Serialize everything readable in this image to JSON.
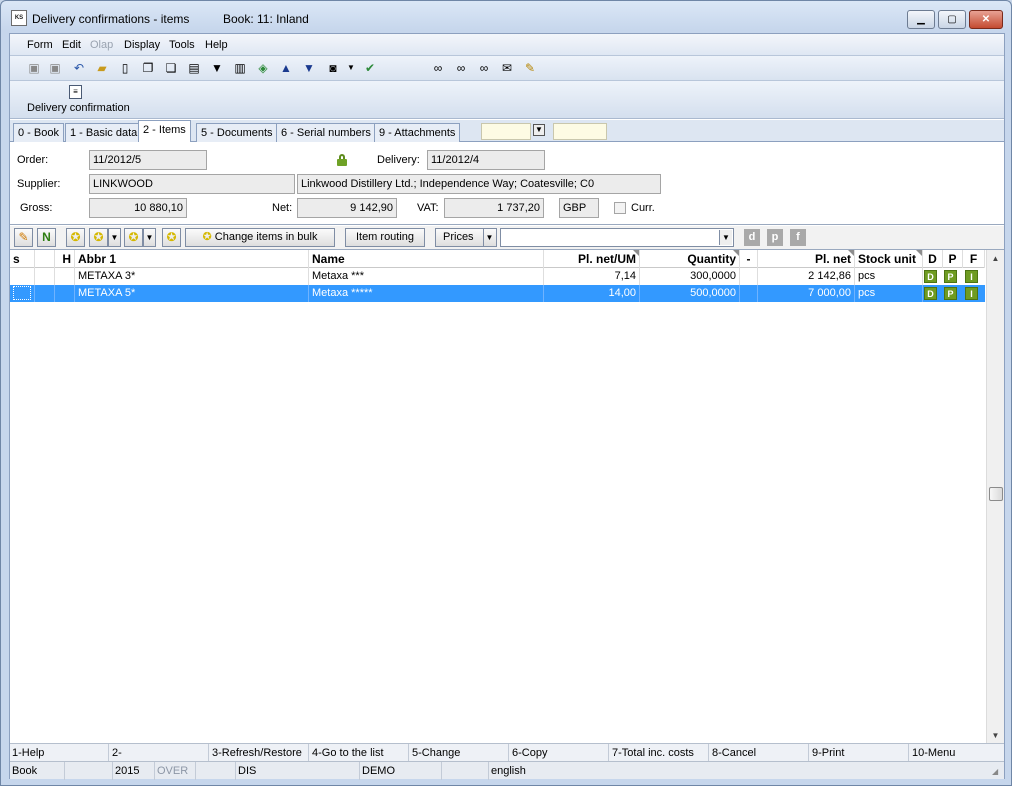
{
  "window": {
    "title": "Delivery confirmations - items",
    "book": "Book: 11: Inland",
    "app_icon": "KS"
  },
  "menu": [
    "Form",
    "Edit",
    "Olap",
    "Display",
    "Tools",
    "Help"
  ],
  "toolbar_icons": [
    "save-icon",
    "save-all-icon",
    "undo-icon",
    "open-folder-icon",
    "new-document-icon",
    "copy-document-icon",
    "paste-document-icon",
    "book-icon",
    "filter-icon",
    "filter-list-icon",
    "stack-icon",
    "arrow-up-icon",
    "arrow-down-icon",
    "camera-icon",
    "dropdown-arrow-icon",
    "check-icon",
    "binoculars-icon",
    "find-next-icon",
    "find-prev-icon",
    "envelope-icon",
    "edit-notes-icon"
  ],
  "actionbar": {
    "label": "Delivery confirmation",
    "icon": "document-icon"
  },
  "tabs": [
    "0 - Book",
    "1 - Basic data",
    "2 - Items",
    "5 - Documents",
    "6 - Serial numbers",
    "9 - Attachments"
  ],
  "form": {
    "order_label": "Order:",
    "order_value": "11/2012/5",
    "delivery_label": "Delivery:",
    "delivery_value": "11/2012/4",
    "supplier_label": "Supplier:",
    "supplier_code": "LINKWOOD",
    "supplier_name": "Linkwood Distillery Ltd.; Independence Way; Coatesville; C0",
    "gross_label": "Gross:",
    "gross_value": "10 880,10",
    "net_label": "Net:",
    "net_value": "9 142,90",
    "vat_label": "VAT:",
    "vat_value": "1 737,20",
    "currency": "GBP",
    "curr_label": "Curr."
  },
  "gridbar": {
    "bulk_label": "Change items in bulk",
    "routing_label": "Item routing",
    "prices_label": "Prices",
    "letters": [
      "d",
      "p",
      "f"
    ],
    "n_label": "N"
  },
  "grid": {
    "headers": [
      "s",
      "",
      "H",
      "Abbr 1",
      "Name",
      "Pl. net/UM",
      "Quantity",
      "-",
      "Pl. net",
      "Stock unit",
      "D",
      "P",
      "F"
    ],
    "rows": [
      {
        "abbr": "METAXA 3*",
        "name": "Metaxa ***",
        "price": "7,14",
        "qty": "300,0000",
        "net": "2 142,86",
        "unit": "pcs",
        "flags": [
          "D",
          "P",
          "I"
        ],
        "selected": false
      },
      {
        "abbr": "METAXA 5*",
        "name": "Metaxa *****",
        "price": "14,00",
        "qty": "500,0000",
        "net": "7 000,00",
        "unit": "pcs",
        "flags": [
          "D",
          "P",
          "I"
        ],
        "selected": true
      }
    ]
  },
  "fkeys": [
    "1-Help",
    "2-",
    "3-Refresh/Restore",
    "4-Go to the list",
    "5-Change",
    "6-Copy",
    "7-Total inc. costs",
    "8-Cancel",
    "9-Print",
    "10-Menu"
  ],
  "status": {
    "section": "Book",
    "year": "2015",
    "over": "OVER",
    "dis": "DIS",
    "db": "DEMO",
    "lang": "english"
  }
}
